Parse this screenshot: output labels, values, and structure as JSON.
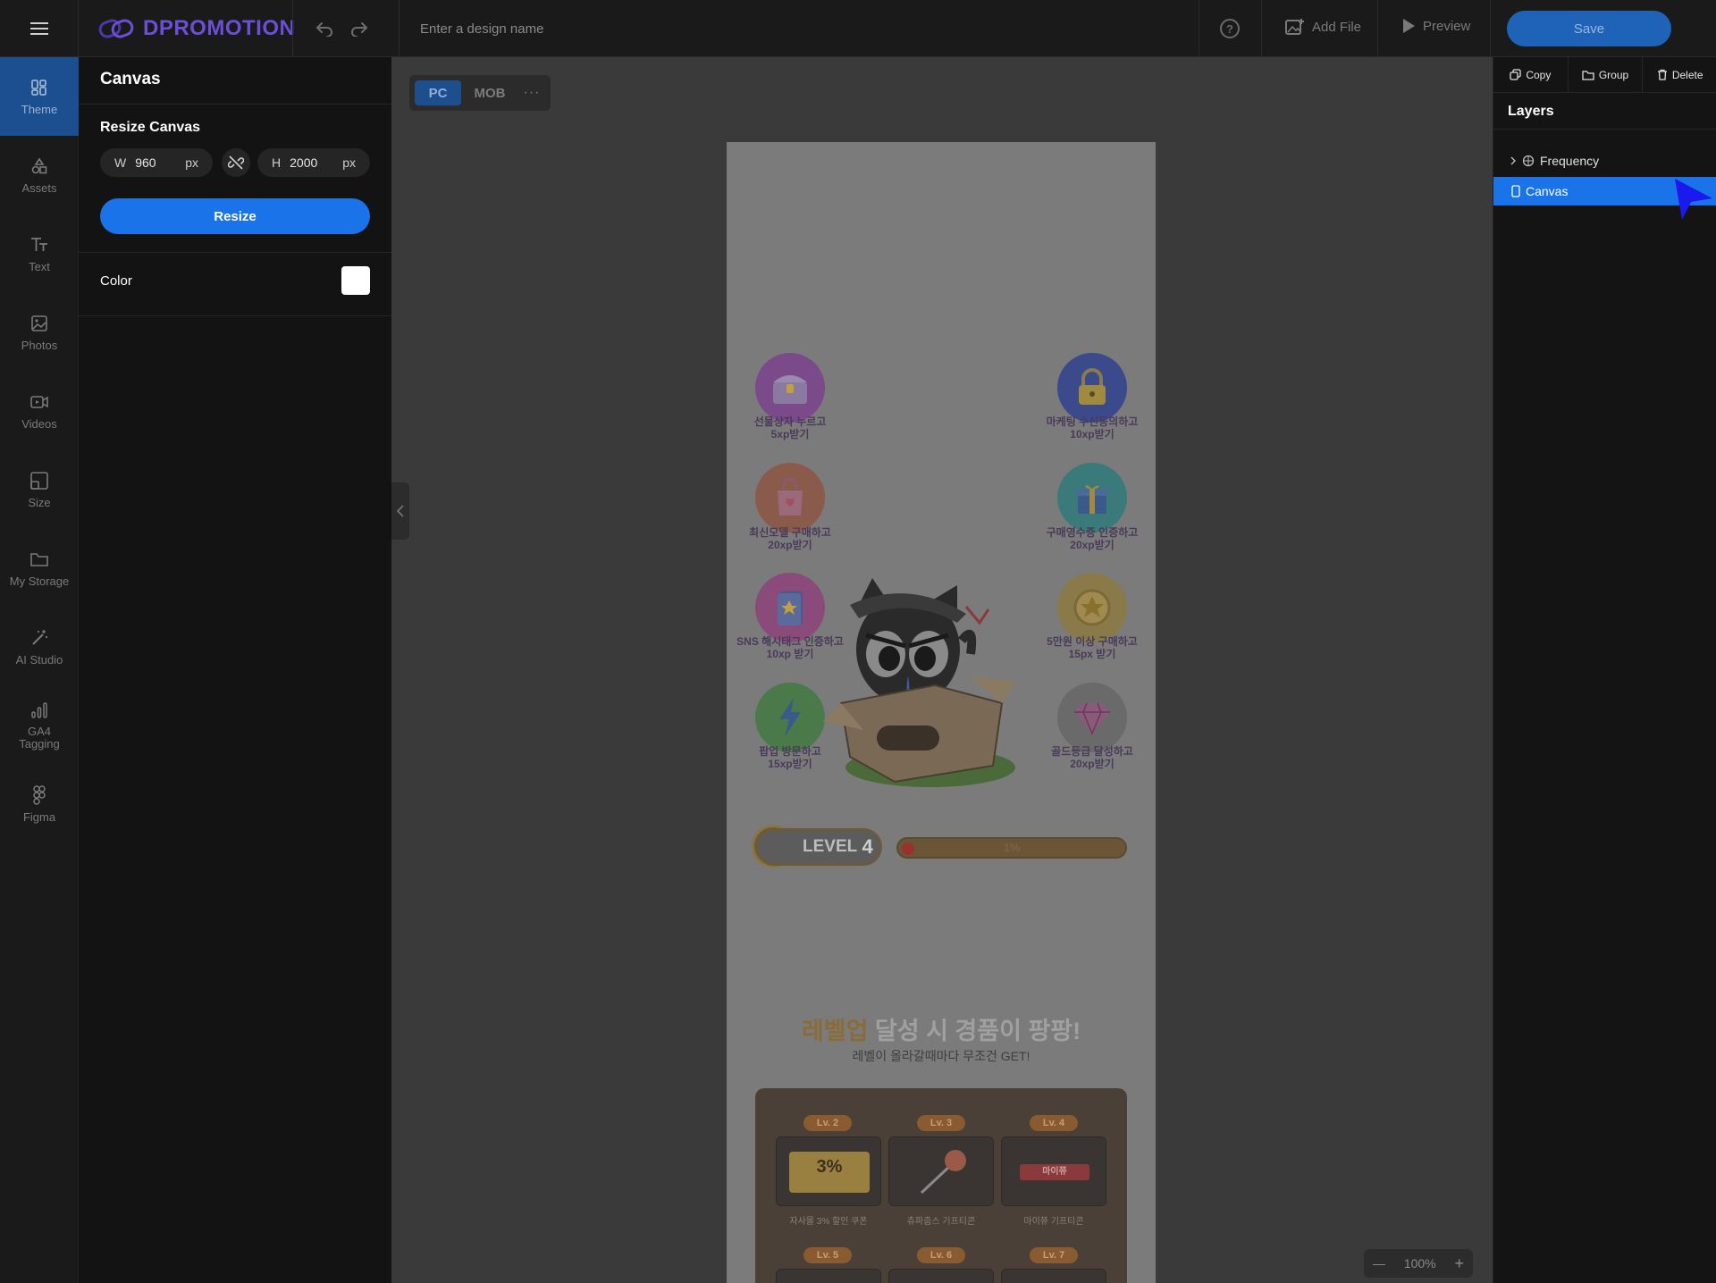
{
  "app": {
    "logo_text": "DPROMOTION",
    "design_name_placeholder": "Enter a design name",
    "add_file_label": "Add File",
    "preview_label": "Preview",
    "save_label": "Save",
    "help_glyph": "?"
  },
  "rail": {
    "items": [
      {
        "label": "Theme",
        "icon": "theme-icon",
        "active": true
      },
      {
        "label": "Assets",
        "icon": "shapes-icon"
      },
      {
        "label": "Text",
        "icon": "text-icon"
      },
      {
        "label": "Photos",
        "icon": "image-icon"
      },
      {
        "label": "Videos",
        "icon": "video-icon"
      },
      {
        "label": "Size",
        "icon": "resize-icon"
      },
      {
        "label": "My Storage",
        "icon": "folder-icon"
      },
      {
        "label": "AI Studio",
        "icon": "magic-wand-icon"
      },
      {
        "label": "GA4 Tagging",
        "icon": "analytics-icon"
      },
      {
        "label": "Figma",
        "icon": "figma-icon"
      }
    ]
  },
  "panel": {
    "title": "Canvas",
    "resize_title": "Resize Canvas",
    "width_label": "W",
    "width_value": "960",
    "height_label": "H",
    "height_value": "2000",
    "unit": "px",
    "resize_button": "Resize",
    "color_label": "Color",
    "color_value": "#ffffff"
  },
  "device": {
    "pc": "PC",
    "mob": "MOB",
    "more": "···"
  },
  "artboard": {
    "badges_left": [
      {
        "caption_1": "선물상자 누르고",
        "caption_2": "5xp받기",
        "color": "#7a4a8a"
      },
      {
        "caption_1": "최신모델 구매하고",
        "caption_2": "20xp받기",
        "color": "#8a5a4a"
      },
      {
        "caption_1": "SNS 해시태그 인증하고",
        "caption_2": "10xp 받기",
        "color": "#8a4a7a"
      },
      {
        "caption_1": "팝업 방문하고",
        "caption_2": "15xp받기",
        "color": "#4a7a4a"
      }
    ],
    "badges_right": [
      {
        "caption_1": "마케팅 수신동의하고",
        "caption_2": "10xp받기",
        "color": "#3a4a8a"
      },
      {
        "caption_1": "구매영수증 인증하고",
        "caption_2": "20xp받기",
        "color": "#3a7a7a"
      },
      {
        "caption_1": "5만원 이상 구매하고",
        "caption_2": "15px 받기",
        "color": "#8a7a4a"
      },
      {
        "caption_1": "골드등급 달성하고",
        "caption_2": "20xp받기",
        "color": "#6a6a6a"
      }
    ],
    "level_label": "LEVEL",
    "level_number": "4",
    "progress_text": "1%",
    "progress_value": 0.01,
    "headline_highlight": "레벨업",
    "headline_rest": " 달성 시 경품이 팡팡!",
    "subline": "레벨이 올라갈때마다 무조건 GET!",
    "rewards": [
      {
        "level": "Lv. 2",
        "caption": "자사몰 3% 할인 쿠폰",
        "card_text": "3%"
      },
      {
        "level": "Lv. 3",
        "caption": "츄파춥스 기프티콘",
        "card_text": ""
      },
      {
        "level": "Lv. 4",
        "caption": "마이쮸 기프티콘",
        "card_text": "마이쮸"
      },
      {
        "level": "Lv. 5",
        "caption": "",
        "card_text": ""
      },
      {
        "level": "Lv. 6",
        "caption": "",
        "card_text": ""
      },
      {
        "level": "Lv. 7",
        "caption": "",
        "card_text": ""
      }
    ]
  },
  "layers": {
    "copy": "Copy",
    "group": "Group",
    "delete": "Delete",
    "title": "Layers",
    "items": [
      {
        "label": "Frequency",
        "selected": false
      },
      {
        "label": "Canvas",
        "selected": true
      }
    ]
  },
  "zoom": {
    "minus": "—",
    "value": "100%",
    "plus": "+"
  }
}
